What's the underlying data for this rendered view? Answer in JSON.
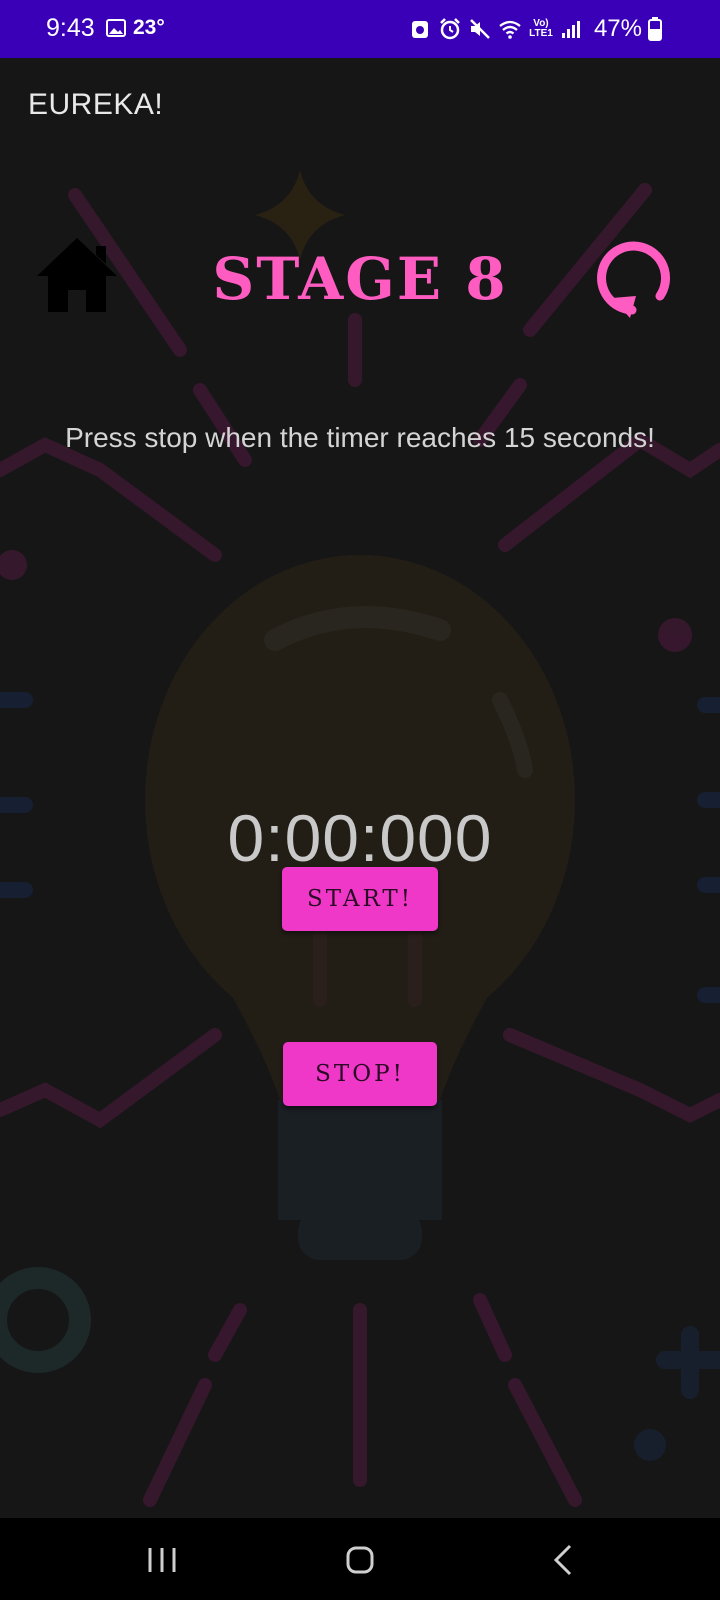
{
  "status_bar": {
    "time": "9:43",
    "temperature": "23°",
    "network_label_top": "Vo)",
    "network_label_bottom": "LTE1",
    "battery_percent": "47%",
    "background_color": "#3a00b8",
    "icons": [
      "gallery-icon",
      "app-notification-icon",
      "alarm-icon",
      "mute-icon",
      "wifi-icon",
      "signal-icon",
      "battery-icon"
    ]
  },
  "app_bar": {
    "title": "EUREKA!"
  },
  "header": {
    "stage_title": "STAGE 8",
    "home_icon": "home-icon",
    "restart_icon": "restart-icon",
    "accent_color": "#ff5cc2"
  },
  "game": {
    "instruction": "Press stop when the timer reaches 15 seconds!",
    "timer": "0:00:000",
    "start_label": "START!",
    "stop_label": "STOP!",
    "button_color": "#f038c8"
  },
  "nav_bar": {
    "icons": [
      "recent-apps-icon",
      "home-nav-icon",
      "back-icon"
    ]
  }
}
